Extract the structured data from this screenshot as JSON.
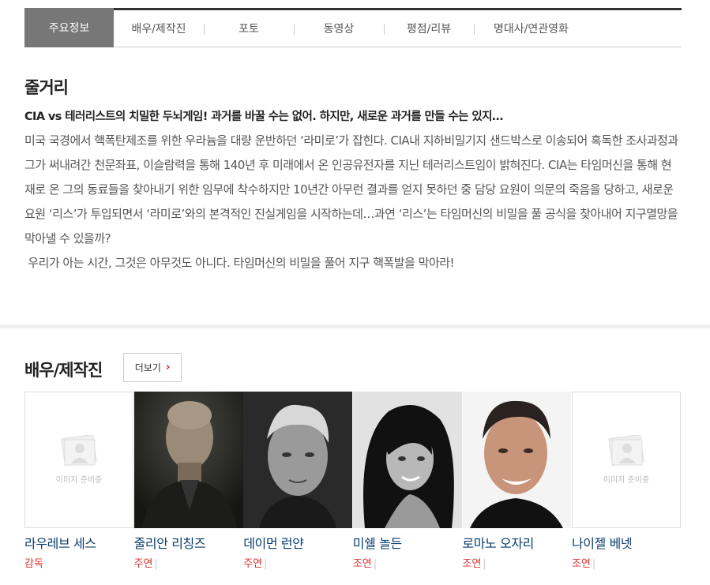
{
  "tabs": [
    {
      "label": "주요정보",
      "active": true
    },
    {
      "label": "배우/제작진"
    },
    {
      "label": "포토"
    },
    {
      "label": "동영상"
    },
    {
      "label": "평점/리뷰"
    },
    {
      "label": "명대사/연관영화"
    }
  ],
  "synopsis": {
    "title": "줄거리",
    "headline": "CIA vs 테러리스트의 치밀한 두뇌게임! 과거를 바꿀 수는 없어. 하지만, 새로운 과거를 만들 수는 있지…",
    "body": [
      "미국 국경에서 핵폭탄제조를 위한 우라늄을 대량 운반하던 ‘라미로’가 잡힌다. CIA내 지하비밀기지 샌드박스로 이송되어 혹독한 조사과정과 그가 써내려간 천문좌표, 이슬람력을 통해 140년 후 미래에서 온 인공유전자를 지닌 테러리스트임이 밝혀진다. CIA는 타임머신을 통해 현재로 온 그의 동료들을 찾아내기 위한 임무에 착수하지만 10년간 아무런 결과를 얻지 못하던 중 담당 요원이 의문의 죽음을 당하고, 새로운 요원 ‘리스’가 투입되면서 ‘라미로’와의 본격적인 진실게임을 시작하는데…과연 ‘리스’는 타임머신의 비밀을 풀 공식을 찾아내어 지구멸망을 막아낼 수 있을까?",
      " 우리가 아는 시간, 그것은 아무것도 아니다. 타임머신의 비밀을 풀어 지구 핵폭발을 막아라!"
    ]
  },
  "cast_section": {
    "title": "배우/제작진",
    "more_label": "더보기",
    "more_icon": "chevron-right-icon",
    "placeholder_text": "이미지 준비중",
    "people": [
      {
        "name": "라우레브 세스",
        "role": "감독",
        "photo": "placeholder"
      },
      {
        "name": "줄리안 리칭즈",
        "role": "주연",
        "photo": "portrait-bald-older-man"
      },
      {
        "name": "데이먼 런얀",
        "role": "주연",
        "photo": "portrait-blond-young-man"
      },
      {
        "name": "미쉘 놀든",
        "role": "조연",
        "photo": "portrait-dark-haired-woman"
      },
      {
        "name": "로마노 오자리",
        "role": "조연",
        "photo": "portrait-smiling-man-color"
      },
      {
        "name": "나이젤 베넷",
        "role": "조연",
        "photo": "placeholder"
      }
    ]
  },
  "colors": {
    "tab_active_bg": "#777777",
    "name_link": "#0a3c6e",
    "role_text": "#dd3333",
    "accent_red": "#ee1111"
  }
}
